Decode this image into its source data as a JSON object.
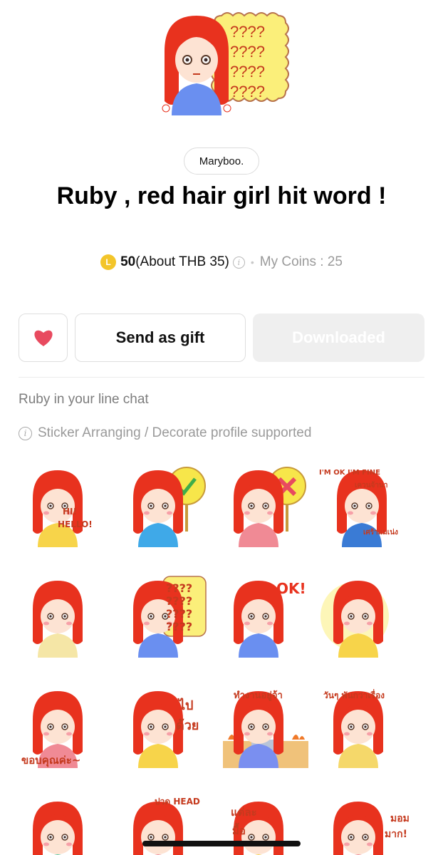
{
  "author": "Maryboo.",
  "title": "Ruby , red hair girl hit word !",
  "price": {
    "coin_symbol": "L",
    "amount": "50",
    "about": "(About THB 35)",
    "info_symbol": "i",
    "separator": "•",
    "my_coins": "My Coins : 25"
  },
  "actions": {
    "favorite_icon": "heart-icon",
    "gift_label": "Send as gift",
    "download_label": "Downloaded"
  },
  "description": "Ruby in your line chat",
  "support_note": "Sticker Arranging / Decorate profile supported",
  "stickers": [
    {
      "id": "s1",
      "texts": [
        "HI!",
        "HELLO!"
      ]
    },
    {
      "id": "s2",
      "texts": []
    },
    {
      "id": "s3",
      "texts": []
    },
    {
      "id": "s4",
      "texts": [
        "I'M OK I'M FINE",
        "เควนจ้านา",
        "เศร้าแมเน่ง"
      ]
    },
    {
      "id": "s5",
      "texts": []
    },
    {
      "id": "s6",
      "texts": [
        "????",
        "????",
        "????",
        "????"
      ]
    },
    {
      "id": "s7",
      "texts": [
        "OK!"
      ]
    },
    {
      "id": "s8",
      "texts": []
    },
    {
      "id": "s9",
      "texts": [
        "ขอบคุณค่ะ~"
      ]
    },
    {
      "id": "s10",
      "texts": [
        "ไป",
        "ด้วย"
      ]
    },
    {
      "id": "s11",
      "texts": [
        "ทำงานอยู่จ้า"
      ]
    },
    {
      "id": "s12",
      "texts": [
        "วันๆ พันกว่าเรื่อง"
      ]
    },
    {
      "id": "s13",
      "texts": []
    },
    {
      "id": "s14",
      "texts": [
        "ปวด HEAD"
      ]
    },
    {
      "id": "s15",
      "texts": [
        "แต่ละ",
        "มื้อ"
      ]
    },
    {
      "id": "s16",
      "texts": [
        "มอม",
        "มาก!"
      ]
    }
  ],
  "hero_texts": [
    "????",
    "????",
    "????",
    "????"
  ],
  "colors": {
    "hair": "#e8321e",
    "skin": "#fde3d3",
    "heart": "#e84a5f",
    "coin": "#f3c52a",
    "question_bubble": "#fbef7a"
  }
}
